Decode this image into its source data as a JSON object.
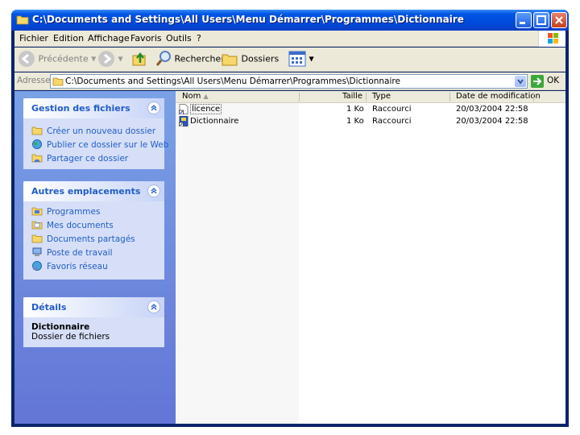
{
  "window": {
    "title": "C:\\Documents and Settings\\All Users\\Menu Démarrer\\Programmes\\Dictionnaire"
  },
  "menu": [
    "Fichier",
    "Edition",
    "Affichage",
    "Favoris",
    "Outils",
    "?"
  ],
  "toolbar": {
    "back_label": "Précédente",
    "search_label": "Rechercher",
    "folders_label": "Dossiers"
  },
  "address": {
    "label": "Adresse",
    "value": "C:\\Documents and Settings\\All Users\\Menu Démarrer\\Programmes\\Dictionnaire",
    "go_label": "OK"
  },
  "left_pane": {
    "file_tasks": {
      "title": "Gestion des fichiers",
      "items": [
        "Créer un nouveau dossier",
        "Publier ce dossier sur le Web",
        "Partager ce dossier"
      ]
    },
    "other_places": {
      "title": "Autres emplacements",
      "items": [
        "Programmes",
        "Mes documents",
        "Documents partagés",
        "Poste de travail",
        "Favoris réseau"
      ]
    },
    "details": {
      "title": "Détails",
      "name": "Dictionnaire",
      "type": "Dossier de fichiers"
    }
  },
  "list": {
    "columns": {
      "name": "Nom",
      "size": "Taille",
      "type": "Type",
      "modified": "Date de modification"
    },
    "rows": [
      {
        "name": "licence",
        "size": "1 Ko",
        "type": "Raccourci",
        "modified": "20/03/2004 22:58"
      },
      {
        "name": "Dictionnaire",
        "size": "1 Ko",
        "type": "Raccourci",
        "modified": "20/03/2004 22:58"
      }
    ]
  },
  "colors": {
    "titlebar": "#0055e5",
    "task_pane": "#6375d6",
    "link_text": "#215dc6"
  }
}
